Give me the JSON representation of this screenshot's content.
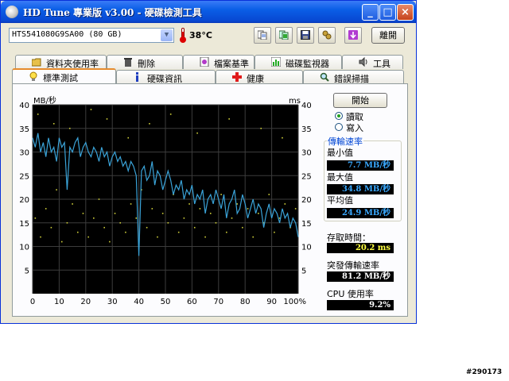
{
  "window": {
    "title": "HD Tune 專業版 v3.00 - 硬碟檢測工具",
    "title_icon": "hdtune-app-icon"
  },
  "toolbar": {
    "drive_value": "HTS541080G9SA00 (80 GB)",
    "temperature": "38",
    "temperature_unit": "°C",
    "exit_label": "離開",
    "buttons": [
      "copy-info-icon",
      "copy-screen-icon",
      "save-icon",
      "options-icon",
      "download-icon"
    ]
  },
  "tabs": {
    "row1": [
      "資料夾使用率",
      "刪除",
      "檔案基準",
      "磁碟監視器",
      "工具"
    ],
    "row2": [
      "標準測試",
      "硬碟資訊",
      "健康",
      "錯誤掃描"
    ],
    "active": "標準測試"
  },
  "side": {
    "start_label": "開始",
    "read_label": "讀取",
    "write_label": "寫入",
    "mode_selected": "讀取",
    "transfer_title": "傳輸速率",
    "min_label": "最小值",
    "min_value": "7.7 MB/秒",
    "max_label": "最大值",
    "max_value": "34.8 MB/秒",
    "avg_label": "平均值",
    "avg_value": "24.9 MB/秒",
    "access_label": "存取時間：",
    "access_value": "20.2 ms",
    "burst_label": "突發傳輸速率",
    "burst_value": "81.2 MB/秒",
    "cpu_label": "CPU 使用率",
    "cpu_value": "9.2%"
  },
  "watermark": "#290173",
  "chart_data": {
    "type": "line",
    "y_left_label": "MB/秒",
    "y_right_label": "ms",
    "y_left_ticks": [
      40,
      35,
      30,
      25,
      20,
      15,
      10,
      5
    ],
    "y_right_ticks": [
      40,
      35,
      30,
      25,
      20,
      15,
      10,
      5
    ],
    "x_ticks": [
      "0",
      "10",
      "20",
      "30",
      "40",
      "50",
      "60",
      "70",
      "80",
      "90",
      "100%"
    ],
    "ylim": [
      0,
      40
    ],
    "xlim": [
      0,
      100
    ],
    "colors": {
      "background": "#000000",
      "grid": "#3c3c3c",
      "transfer": "#3aa3d8",
      "access": "#cfcf3a"
    },
    "series": [
      {
        "name": "transfer",
        "x": [
          0,
          1,
          2,
          3,
          4,
          5,
          6,
          7,
          8,
          9,
          10,
          11,
          12,
          13,
          14,
          15,
          16,
          17,
          18,
          19,
          20,
          21,
          22,
          23,
          24,
          25,
          26,
          27,
          28,
          29,
          30,
          31,
          32,
          33,
          34,
          35,
          36,
          37,
          38,
          39,
          40,
          41,
          42,
          43,
          44,
          45,
          46,
          47,
          48,
          49,
          50,
          51,
          52,
          53,
          54,
          55,
          56,
          57,
          58,
          59,
          60,
          61,
          62,
          63,
          64,
          65,
          66,
          67,
          68,
          69,
          70,
          71,
          72,
          73,
          74,
          75,
          76,
          77,
          78,
          79,
          80,
          81,
          82,
          83,
          84,
          85,
          86,
          87,
          88,
          89,
          90,
          91,
          92,
          93,
          94,
          95,
          96,
          97,
          98,
          99,
          100
        ],
        "y": [
          33,
          31,
          34,
          30,
          32,
          29,
          33,
          30,
          31,
          28,
          33,
          31,
          32,
          22,
          31,
          30,
          32,
          33,
          29,
          31,
          32,
          30,
          29,
          31,
          30,
          28,
          31,
          29,
          30,
          27,
          29,
          30,
          28,
          29,
          27,
          28,
          26,
          28,
          27,
          25,
          8,
          26,
          27,
          24,
          25,
          28,
          23,
          26,
          25,
          22,
          24,
          26,
          24,
          21,
          23,
          22,
          24,
          20,
          22,
          21,
          23,
          19,
          21,
          20,
          22,
          17,
          20,
          21,
          19,
          22,
          20,
          18,
          21,
          16,
          19,
          20,
          22,
          17,
          18,
          21,
          19,
          16,
          18,
          20,
          17,
          19,
          18,
          14,
          17,
          19,
          16,
          18,
          17,
          15,
          18,
          16,
          17,
          14,
          16,
          15,
          12
        ]
      },
      {
        "name": "access",
        "x": [
          1,
          3,
          5,
          7,
          9,
          11,
          13,
          15,
          17,
          19,
          21,
          23,
          25,
          27,
          29,
          31,
          33,
          35,
          37,
          39,
          41,
          43,
          45,
          47,
          49,
          51,
          53,
          55,
          57,
          59,
          61,
          63,
          65,
          67,
          69,
          71,
          73,
          75,
          77,
          79,
          81,
          83,
          85,
          87,
          89,
          91,
          93,
          95,
          97,
          99,
          2,
          8,
          14,
          22,
          28,
          36,
          44,
          52,
          62,
          74,
          86,
          94
        ],
        "y": [
          16,
          12,
          18,
          14,
          22,
          11,
          15,
          19,
          13,
          17,
          12,
          16,
          20,
          14,
          11,
          17,
          15,
          13,
          19,
          16,
          22,
          14,
          18,
          12,
          17,
          15,
          21,
          13,
          16,
          19,
          14,
          18,
          12,
          17,
          15,
          21,
          13,
          16,
          19,
          14,
          18,
          12,
          17,
          15,
          21,
          13,
          16,
          19,
          14,
          18,
          38,
          36,
          35,
          39,
          37,
          33,
          36,
          38,
          34,
          37,
          35,
          33
        ]
      }
    ]
  }
}
